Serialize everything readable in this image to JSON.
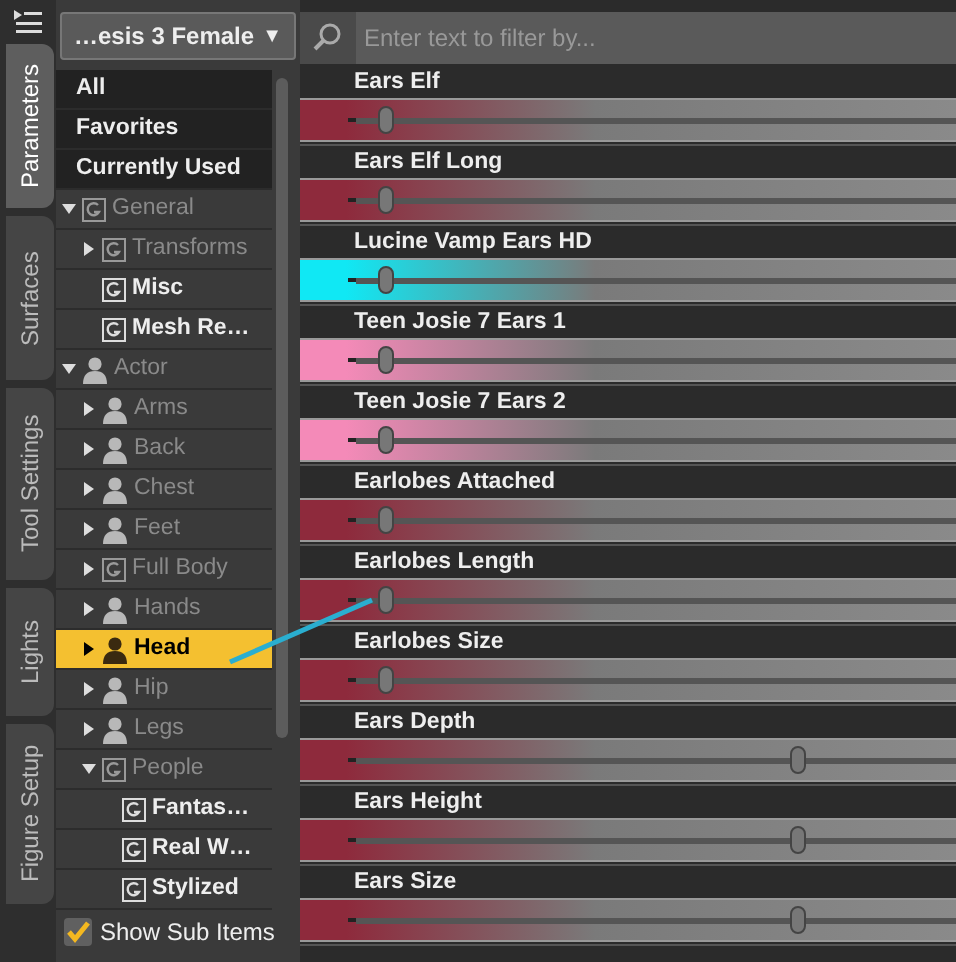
{
  "side_tabs": [
    {
      "label": "Parameters",
      "selected": true
    },
    {
      "label": "Surfaces",
      "selected": false
    },
    {
      "label": "Tool Settings",
      "selected": false
    },
    {
      "label": "Lights",
      "selected": false
    },
    {
      "label": "Figure Setup",
      "selected": false
    }
  ],
  "figure_dropdown": {
    "value": "…esis 3 Female",
    "caret": "▼"
  },
  "tree": [
    {
      "label": "All",
      "kind": "filter",
      "selected": false,
      "disabled": false
    },
    {
      "label": "Favorites",
      "kind": "filter",
      "selected": false,
      "disabled": false
    },
    {
      "label": "Currently Used",
      "kind": "filter",
      "selected": false,
      "disabled": false
    },
    {
      "label": "General",
      "kind": "group",
      "selected": false,
      "disabled": true,
      "expanded": true,
      "children": [
        {
          "label": "Transforms",
          "kind": "group",
          "selected": false,
          "disabled": true,
          "expanded": false
        },
        {
          "label": "Misc",
          "kind": "group",
          "selected": false,
          "disabled": false
        },
        {
          "label": "Mesh Re…",
          "kind": "group",
          "selected": false,
          "disabled": false
        }
      ]
    },
    {
      "label": "Actor",
      "kind": "figure",
      "selected": false,
      "disabled": true,
      "expanded": true,
      "children": [
        {
          "label": "Arms",
          "kind": "figure",
          "selected": false,
          "disabled": true,
          "expanded": false
        },
        {
          "label": "Back",
          "kind": "figure",
          "selected": false,
          "disabled": true,
          "expanded": false
        },
        {
          "label": "Chest",
          "kind": "figure",
          "selected": false,
          "disabled": true,
          "expanded": false
        },
        {
          "label": "Feet",
          "kind": "figure",
          "selected": false,
          "disabled": true,
          "expanded": false
        },
        {
          "label": "Full Body",
          "kind": "group",
          "selected": false,
          "disabled": true,
          "expanded": false
        },
        {
          "label": "Hands",
          "kind": "figure",
          "selected": false,
          "disabled": true,
          "expanded": false
        },
        {
          "label": "Head",
          "kind": "figure",
          "selected": true,
          "disabled": false,
          "expanded": false
        },
        {
          "label": "Hip",
          "kind": "figure",
          "selected": false,
          "disabled": true,
          "expanded": false
        },
        {
          "label": "Legs",
          "kind": "figure",
          "selected": false,
          "disabled": true,
          "expanded": false
        },
        {
          "label": "People",
          "kind": "group",
          "selected": false,
          "disabled": true,
          "expanded": true,
          "children": [
            {
              "label": "Fantas…",
              "kind": "group",
              "selected": false,
              "disabled": false
            },
            {
              "label": "Real W…",
              "kind": "group",
              "selected": false,
              "disabled": false
            },
            {
              "label": "Stylized",
              "kind": "group",
              "selected": false,
              "disabled": false
            }
          ]
        }
      ]
    }
  ],
  "show_sub_items": {
    "label": "Show Sub Items",
    "checked": true
  },
  "filter": {
    "placeholder": "Enter text to filter by..."
  },
  "sliders": [
    {
      "name": "Ears Elf",
      "color": "#8e2a3c",
      "level": 0.13
    },
    {
      "name": "Ears Elf Long",
      "color": "#8e2a3c",
      "level": 0.13
    },
    {
      "name": "Lucine Vamp Ears HD",
      "color": "#10e8f4",
      "level": 0.13
    },
    {
      "name": "Teen Josie 7 Ears 1",
      "color": "#f48ab8",
      "level": 0.13
    },
    {
      "name": "Teen Josie 7 Ears 2",
      "color": "#f48ab8",
      "level": 0.13
    },
    {
      "name": "Earlobes Attached",
      "color": "#8e2a3c",
      "level": 0.13
    },
    {
      "name": "Earlobes Length",
      "color": "#8e2a3c",
      "level": 0.13
    },
    {
      "name": "Earlobes Size",
      "color": "#8e2a3c",
      "level": 0.13
    },
    {
      "name": "Ears Depth",
      "color": "#8e2a3c",
      "level": 0.76
    },
    {
      "name": "Ears Height",
      "color": "#8e2a3c",
      "level": 0.76
    },
    {
      "name": "Ears Size",
      "color": "#8e2a3c",
      "level": 0.76
    }
  ]
}
